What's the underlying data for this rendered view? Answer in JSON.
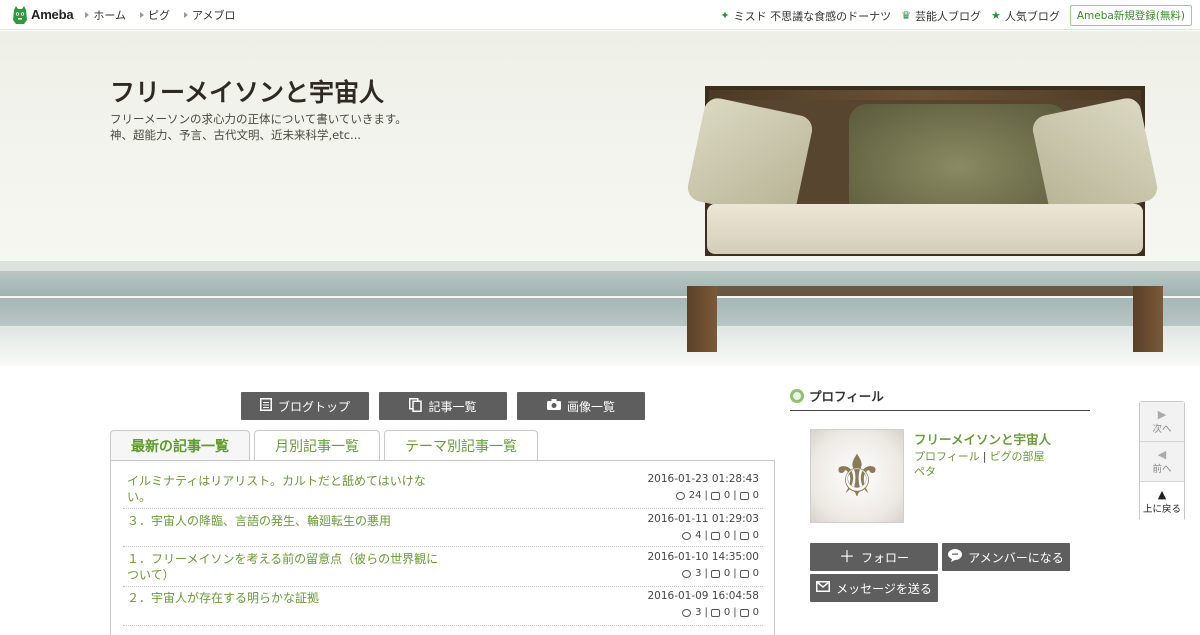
{
  "topbar": {
    "logo_text": "Ameba",
    "nav": [
      {
        "label": "ホーム"
      },
      {
        "label": "ピグ"
      },
      {
        "label": "アメブロ"
      }
    ],
    "promo": "ミスド 不思議な食感のドーナツ",
    "celeb_blog": "芸能人ブログ",
    "popular_blog": "人気ブログ",
    "register": "Ameba新規登録(無料)"
  },
  "header": {
    "title": "フリーメイソンと宇宙人",
    "description_line1": "フリーメーソンの求心力の正体について書いていきます。",
    "description_line2": "神、超能力、予言、古代文明、近未来科学,etc..."
  },
  "toolbar": {
    "blog_top": "ブログトップ",
    "article_list": "記事一覧",
    "image_list": "画像一覧"
  },
  "tabs": [
    {
      "label": "最新の記事一覧",
      "active": true
    },
    {
      "label": "月別記事一覧",
      "active": false
    },
    {
      "label": "テーマ別記事一覧",
      "active": false
    }
  ],
  "entries": [
    {
      "title": "イルミナティはリアリスト。カルトだと舐めてはいけない。",
      "date": "2016-01-23 01:28:43",
      "likes": "24",
      "reblogs": "0",
      "comments": "0"
    },
    {
      "title": "３．宇宙人の降臨、言語の発生、輪廻転生の悪用",
      "date": "2016-01-11 01:29:03",
      "likes": "4",
      "reblogs": "0",
      "comments": "0"
    },
    {
      "title": "１．フリーメイソンを考える前の留意点（彼らの世界観について）",
      "date": "2016-01-10 14:35:00",
      "likes": "3",
      "reblogs": "0",
      "comments": "0"
    },
    {
      "title": "２．宇宙人が存在する明らかな証拠",
      "date": "2016-01-09 16:04:58",
      "likes": "3",
      "reblogs": "0",
      "comments": "0"
    }
  ],
  "profile": {
    "heading": "プロフィール",
    "name": "フリーメイソンと宇宙人",
    "link_profile": "プロフィール",
    "link_pig_room": "ピグの部屋",
    "link_peta": "ペタ",
    "follow": "フォロー",
    "amember": "アメンバーになる",
    "message": "メッセージを送る"
  },
  "sidenav": {
    "next": "次へ",
    "prev": "前へ",
    "top": "上に戻る"
  },
  "colors": {
    "accent_green": "#6a9a3a",
    "button_gray": "#5e5e5e",
    "star_green": "#2f8f3a"
  }
}
